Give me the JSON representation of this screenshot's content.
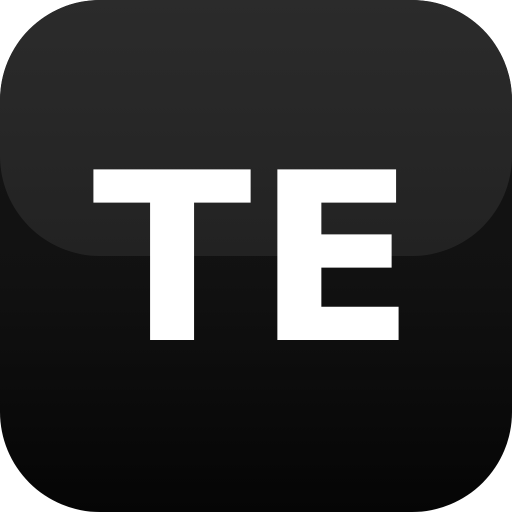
{
  "app_icon": {
    "label": "TE",
    "colors": {
      "background_top": "#161616",
      "background_bottom": "#050505",
      "gloss": "#2a2a2a",
      "label": "#ffffff"
    }
  }
}
